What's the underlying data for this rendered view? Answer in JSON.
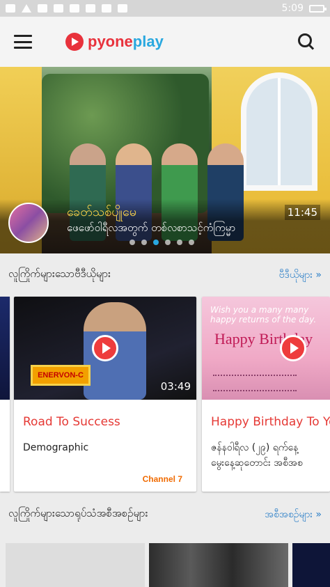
{
  "status_bar": {
    "time": "5:09"
  },
  "app": {
    "logo_text_a": "pyone",
    "logo_text_b": "play",
    "menu_icon": "hamburger-menu-icon",
    "search_icon": "search-icon"
  },
  "hero": {
    "title": "ခေတ်သစ်ပျိုမေ",
    "subtitle": "ဖေဖော်ဝါရီလအတွက် တစ်လစာသင့်ကံကြမ္မာ",
    "time": "11:45",
    "dots_total": 6,
    "dots_active_index": 2
  },
  "sections": [
    {
      "title": "လူကြိုက်များသောဗီဒီယိုများ",
      "more": "ဗီဒီယိုများ »",
      "cards": [
        {
          "title": "Road To Success",
          "desc": "Demographic",
          "duration": "03:49",
          "channel": "Channel 7",
          "podium_text": "ENERVON-C"
        },
        {
          "title": "Happy Birthday To Yo",
          "desc_line1": "ဇန်နဝါရီလ (၂၉) ရက်နေ့",
          "desc_line2": "မွေးနေ့ဆုတောင်း အစီအစ",
          "thumb_wish": "Wish you a many many happy returns of the day.",
          "thumb_title": "Happy Birthday"
        }
      ]
    },
    {
      "title": "လူကြိုက်များသောရုပ်သံအစီအစဉ်များ",
      "more": "အစီအစဉ်များ »"
    }
  ],
  "colors": {
    "brand_red": "#e8323c",
    "brand_blue": "#29a8df",
    "link_blue": "#2a7ec7",
    "title_red": "#e53935"
  }
}
